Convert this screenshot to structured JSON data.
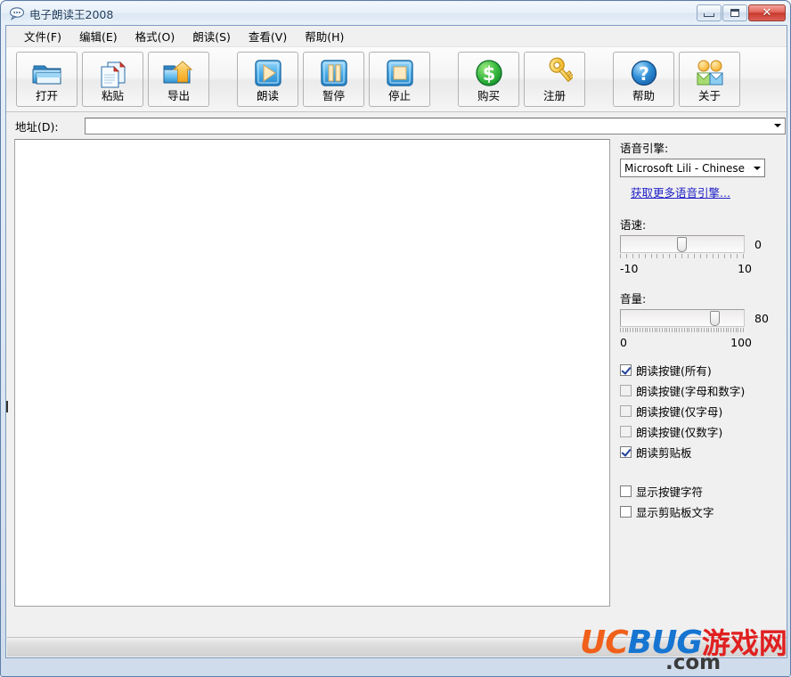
{
  "window": {
    "title": "电子朗读王2008",
    "icon": "speech-bubble-icon",
    "controls": {
      "minimize": "最小化",
      "maximize": "最大化",
      "close": "✕"
    }
  },
  "menubar": {
    "items": [
      {
        "label": "文件(F)",
        "name": "menu-file"
      },
      {
        "label": "编辑(E)",
        "name": "menu-edit"
      },
      {
        "label": "格式(O)",
        "name": "menu-format"
      },
      {
        "label": "朗读(S)",
        "name": "menu-speak"
      },
      {
        "label": "查看(V)",
        "name": "menu-view"
      },
      {
        "label": "帮助(H)",
        "name": "menu-help"
      }
    ]
  },
  "toolbar": {
    "buttons": [
      {
        "label": "打开",
        "icon": "open-folder-icon",
        "gap": false
      },
      {
        "label": "粘贴",
        "icon": "paste-icon",
        "gap": false
      },
      {
        "label": "导出",
        "icon": "export-folder-arrow-icon",
        "gap": false
      },
      {
        "label": "朗读",
        "icon": "play-icon",
        "gap": true
      },
      {
        "label": "暂停",
        "icon": "pause-icon",
        "gap": false
      },
      {
        "label": "停止",
        "icon": "stop-icon",
        "gap": false
      },
      {
        "label": "购买",
        "icon": "dollar-circle-icon",
        "gap": true
      },
      {
        "label": "注册",
        "icon": "key-icon",
        "gap": false
      },
      {
        "label": "帮助",
        "icon": "question-circle-icon",
        "gap": true
      },
      {
        "label": "关于",
        "icon": "two-people-icon",
        "gap": false
      }
    ]
  },
  "address": {
    "label": "地址(D):",
    "value": "",
    "placeholder": ""
  },
  "editor": {
    "value": "",
    "placeholder": ""
  },
  "sidepanel": {
    "voice_engine": {
      "label": "语音引擎:",
      "selected": "Microsoft Lili - Chinese (Chin",
      "more_link": "获取更多语音引擎..."
    },
    "rate": {
      "label": "语速:",
      "value": "0",
      "min_label": "-10",
      "max_label": "10",
      "min": -10,
      "max": 10,
      "current": 0
    },
    "volume": {
      "label": "音量:",
      "value": "80",
      "min_label": "0",
      "max_label": "100",
      "min": 0,
      "max": 100,
      "current": 80
    },
    "checkboxes": [
      {
        "label": "朗读按键(所有)",
        "checked": true,
        "dim": false,
        "name": "checkbox-speak-keys-all"
      },
      {
        "label": "朗读按键(字母和数字)",
        "checked": false,
        "dim": true,
        "name": "checkbox-speak-keys-alnum"
      },
      {
        "label": "朗读按键(仅字母)",
        "checked": false,
        "dim": true,
        "name": "checkbox-speak-keys-letters"
      },
      {
        "label": "朗读按键(仅数字)",
        "checked": false,
        "dim": true,
        "name": "checkbox-speak-keys-digits"
      },
      {
        "label": "朗读剪贴板",
        "checked": true,
        "dim": false,
        "name": "checkbox-speak-clipboard"
      }
    ],
    "checkboxes2": [
      {
        "label": "显示按键字符",
        "checked": false,
        "dim": false,
        "name": "checkbox-show-key-chars"
      },
      {
        "label": "显示剪贴板文字",
        "checked": false,
        "dim": false,
        "name": "checkbox-show-clipboard-text"
      }
    ]
  },
  "watermark": {
    "uc": "UC",
    "bug": "BUG",
    "cn": "游戏网",
    "dotcom": ".com",
    "colors": {
      "uc": "#f0601a",
      "bug": "#1675d1",
      "cn": "#e02020",
      "dotcom": "#3b3b3b"
    }
  }
}
